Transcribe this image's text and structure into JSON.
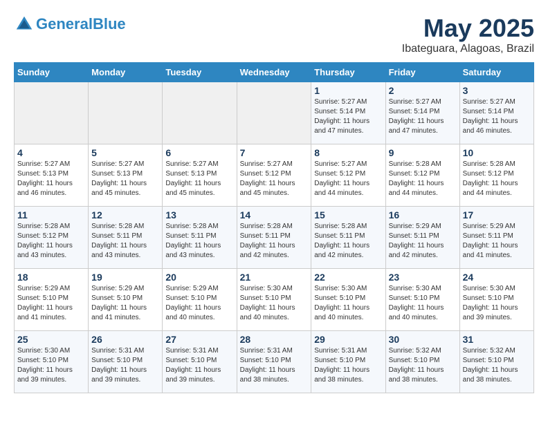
{
  "header": {
    "logo_line1": "General",
    "logo_line2": "Blue",
    "month_title": "May 2025",
    "subtitle": "Ibateguara, Alagoas, Brazil"
  },
  "days_of_week": [
    "Sunday",
    "Monday",
    "Tuesday",
    "Wednesday",
    "Thursday",
    "Friday",
    "Saturday"
  ],
  "weeks": [
    [
      {
        "day": "",
        "info": ""
      },
      {
        "day": "",
        "info": ""
      },
      {
        "day": "",
        "info": ""
      },
      {
        "day": "",
        "info": ""
      },
      {
        "day": "1",
        "info": "Sunrise: 5:27 AM\nSunset: 5:14 PM\nDaylight: 11 hours and 47 minutes."
      },
      {
        "day": "2",
        "info": "Sunrise: 5:27 AM\nSunset: 5:14 PM\nDaylight: 11 hours and 47 minutes."
      },
      {
        "day": "3",
        "info": "Sunrise: 5:27 AM\nSunset: 5:14 PM\nDaylight: 11 hours and 46 minutes."
      }
    ],
    [
      {
        "day": "4",
        "info": "Sunrise: 5:27 AM\nSunset: 5:13 PM\nDaylight: 11 hours and 46 minutes."
      },
      {
        "day": "5",
        "info": "Sunrise: 5:27 AM\nSunset: 5:13 PM\nDaylight: 11 hours and 45 minutes."
      },
      {
        "day": "6",
        "info": "Sunrise: 5:27 AM\nSunset: 5:13 PM\nDaylight: 11 hours and 45 minutes."
      },
      {
        "day": "7",
        "info": "Sunrise: 5:27 AM\nSunset: 5:12 PM\nDaylight: 11 hours and 45 minutes."
      },
      {
        "day": "8",
        "info": "Sunrise: 5:27 AM\nSunset: 5:12 PM\nDaylight: 11 hours and 44 minutes."
      },
      {
        "day": "9",
        "info": "Sunrise: 5:28 AM\nSunset: 5:12 PM\nDaylight: 11 hours and 44 minutes."
      },
      {
        "day": "10",
        "info": "Sunrise: 5:28 AM\nSunset: 5:12 PM\nDaylight: 11 hours and 44 minutes."
      }
    ],
    [
      {
        "day": "11",
        "info": "Sunrise: 5:28 AM\nSunset: 5:12 PM\nDaylight: 11 hours and 43 minutes."
      },
      {
        "day": "12",
        "info": "Sunrise: 5:28 AM\nSunset: 5:11 PM\nDaylight: 11 hours and 43 minutes."
      },
      {
        "day": "13",
        "info": "Sunrise: 5:28 AM\nSunset: 5:11 PM\nDaylight: 11 hours and 43 minutes."
      },
      {
        "day": "14",
        "info": "Sunrise: 5:28 AM\nSunset: 5:11 PM\nDaylight: 11 hours and 42 minutes."
      },
      {
        "day": "15",
        "info": "Sunrise: 5:28 AM\nSunset: 5:11 PM\nDaylight: 11 hours and 42 minutes."
      },
      {
        "day": "16",
        "info": "Sunrise: 5:29 AM\nSunset: 5:11 PM\nDaylight: 11 hours and 42 minutes."
      },
      {
        "day": "17",
        "info": "Sunrise: 5:29 AM\nSunset: 5:11 PM\nDaylight: 11 hours and 41 minutes."
      }
    ],
    [
      {
        "day": "18",
        "info": "Sunrise: 5:29 AM\nSunset: 5:10 PM\nDaylight: 11 hours and 41 minutes."
      },
      {
        "day": "19",
        "info": "Sunrise: 5:29 AM\nSunset: 5:10 PM\nDaylight: 11 hours and 41 minutes."
      },
      {
        "day": "20",
        "info": "Sunrise: 5:29 AM\nSunset: 5:10 PM\nDaylight: 11 hours and 40 minutes."
      },
      {
        "day": "21",
        "info": "Sunrise: 5:30 AM\nSunset: 5:10 PM\nDaylight: 11 hours and 40 minutes."
      },
      {
        "day": "22",
        "info": "Sunrise: 5:30 AM\nSunset: 5:10 PM\nDaylight: 11 hours and 40 minutes."
      },
      {
        "day": "23",
        "info": "Sunrise: 5:30 AM\nSunset: 5:10 PM\nDaylight: 11 hours and 40 minutes."
      },
      {
        "day": "24",
        "info": "Sunrise: 5:30 AM\nSunset: 5:10 PM\nDaylight: 11 hours and 39 minutes."
      }
    ],
    [
      {
        "day": "25",
        "info": "Sunrise: 5:30 AM\nSunset: 5:10 PM\nDaylight: 11 hours and 39 minutes."
      },
      {
        "day": "26",
        "info": "Sunrise: 5:31 AM\nSunset: 5:10 PM\nDaylight: 11 hours and 39 minutes."
      },
      {
        "day": "27",
        "info": "Sunrise: 5:31 AM\nSunset: 5:10 PM\nDaylight: 11 hours and 39 minutes."
      },
      {
        "day": "28",
        "info": "Sunrise: 5:31 AM\nSunset: 5:10 PM\nDaylight: 11 hours and 38 minutes."
      },
      {
        "day": "29",
        "info": "Sunrise: 5:31 AM\nSunset: 5:10 PM\nDaylight: 11 hours and 38 minutes."
      },
      {
        "day": "30",
        "info": "Sunrise: 5:32 AM\nSunset: 5:10 PM\nDaylight: 11 hours and 38 minutes."
      },
      {
        "day": "31",
        "info": "Sunrise: 5:32 AM\nSunset: 5:10 PM\nDaylight: 11 hours and 38 minutes."
      }
    ]
  ]
}
